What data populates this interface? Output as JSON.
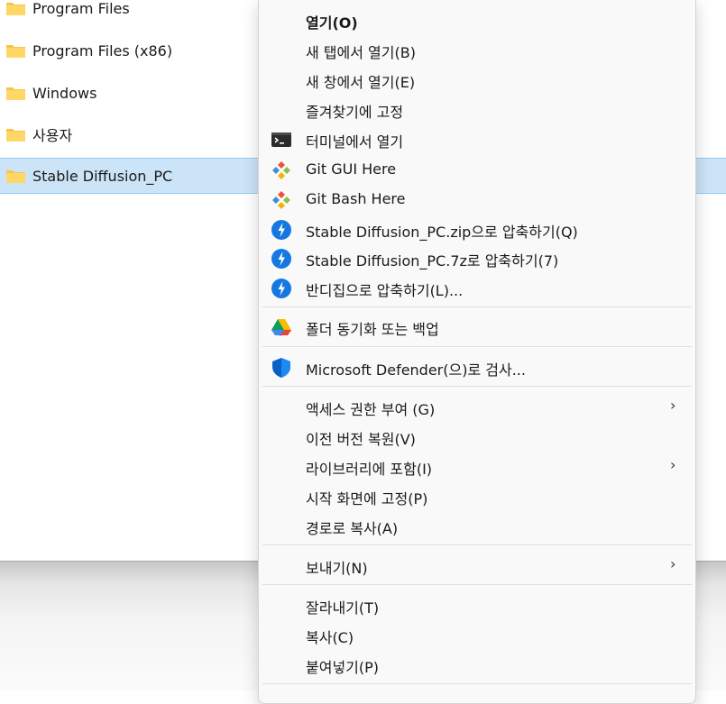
{
  "explorer": {
    "files": [
      {
        "name": "Program Files",
        "icon": "folder-icon",
        "selected": false
      },
      {
        "name": "Program Files (x86)",
        "icon": "folder-icon",
        "selected": false
      },
      {
        "name": "Windows",
        "icon": "folder-icon",
        "selected": false
      },
      {
        "name": "사용자",
        "icon": "folder-icon",
        "selected": false
      },
      {
        "name": "Stable Diffusion_PC",
        "icon": "folder-icon",
        "selected": true
      }
    ],
    "folder_color": "#f8c44b",
    "selection_color": "#cce4f7"
  },
  "menu": {
    "items": [
      {
        "label": "열기(O)",
        "icon": null,
        "bold": true
      },
      {
        "label": "새 탭에서 열기(B)",
        "icon": null
      },
      {
        "label": "새 창에서 열기(E)",
        "icon": null
      },
      {
        "label": "즐겨찾기에 고정",
        "icon": null
      },
      {
        "label": "터미널에서 열기",
        "icon": "terminal-icon"
      },
      {
        "label": "Git GUI Here",
        "icon": "git-gui-icon"
      },
      {
        "label": "Git Bash Here",
        "icon": "git-bash-icon"
      },
      {
        "label": "Stable Diffusion_PC.zip으로 압축하기(Q)",
        "icon": "bandizip-icon"
      },
      {
        "label": "Stable Diffusion_PC.7z로 압축하기(7)",
        "icon": "bandizip-icon"
      },
      {
        "label": "반디집으로 압축하기(L)...",
        "icon": "bandizip-icon"
      },
      {
        "label": "폴더 동기화 또는 백업",
        "icon": "google-drive-icon"
      },
      {
        "label": "Microsoft Defender(으)로 검사...",
        "icon": "defender-shield-icon"
      },
      {
        "label": "액세스 권한 부여 (G)",
        "icon": null,
        "submenu": true
      },
      {
        "label": "이전 버전 복원(V)",
        "icon": null
      },
      {
        "label": "라이브러리에 포함(I)",
        "icon": null,
        "submenu": true
      },
      {
        "label": "시작 화면에 고정(P)",
        "icon": null
      },
      {
        "label": "경로로 복사(A)",
        "icon": null
      },
      {
        "label": "보내기(N)",
        "icon": null,
        "submenu": true
      },
      {
        "label": "잘라내기(T)",
        "icon": null
      },
      {
        "label": "복사(C)",
        "icon": null
      },
      {
        "label": "붙여넣기(P)",
        "icon": null
      }
    ],
    "submenu_arrow": "›"
  }
}
